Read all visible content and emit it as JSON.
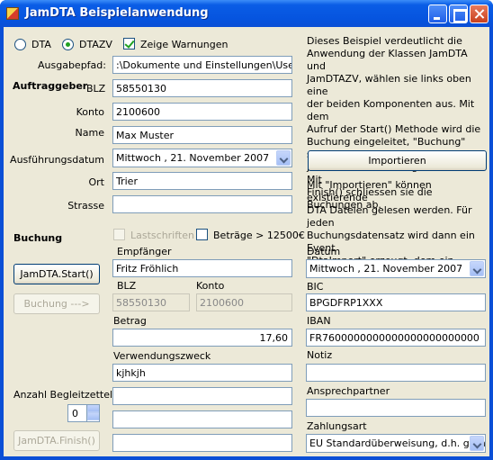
{
  "window": {
    "title": "JamDTA Beispielanwendung",
    "buttons": {
      "minimize": "minimize-icon",
      "maximize": "maximize-icon",
      "close": "close-icon"
    }
  },
  "mode": {
    "dta_label": "DTA",
    "dtazv_label": "DTAZV",
    "selected": "DTAZV",
    "warn_label": "Zeige Warnungen",
    "warn_checked": true
  },
  "output": {
    "label": "Ausgabepfad:",
    "value": ":\\Dokumente und Einstellungen\\User"
  },
  "auftraggeber": {
    "section_label": "Auftraggeber",
    "blz_label": "BLZ",
    "blz_value": "58550130",
    "konto_label": "Konto",
    "konto_value": "2100600",
    "name_label": "Name",
    "name_value": "Max Muster",
    "date_label": "Ausführungsdatum",
    "date_value": "Mittwoch  , 21. November 2007",
    "ort_label": "Ort",
    "ort_value": "Trier",
    "strasse_label": "Strasse",
    "strasse_value": ""
  },
  "buchung": {
    "section_label": "Buchung",
    "lastschriften_label": "Lastschriften",
    "betraege_label": "Beträge > 12500€",
    "empfaenger_label": "Empfänger",
    "empfaenger_value": "Fritz Fröhlich",
    "blz_label": "BLZ",
    "blz_value": "58550130",
    "konto_label": "Konto",
    "konto_value": "2100600",
    "betrag_label": "Betrag",
    "betrag_value": "17,60",
    "zweck_label": "Verwendungszweck",
    "zweck_value": "kjhkjh",
    "start_button": "JamDTA.Start()",
    "buchung_button": "Buchung --->",
    "finish_button": "JamDTA.Finish()",
    "begleitzettel_label": "Anzahl Begleitzettel",
    "begleitzettel_value": "0"
  },
  "right": {
    "intro_text": "Dieses Beispiel verdeutlicht die\nAnwendung der Klassen JamDTA und\nJamDTAZV, wählen sie links oben eine\nder beiden Komponenten aus. Mit dem\nAufruf der Start() Methode wird die\nBuchung eingeleitet, \"Buchung\" schreibt\njeweils einen Buchungsdatensatz. Mit\nFinish() schliessen sie die Buchungen ab.",
    "import_button": "Importieren",
    "import_text": "Mit \"Importieren\" können existierende\nDTA Dateien gelesen werden. Für jeden\nBuchungsdatensatz wird dann ein Event\n\"DtaImport\" erzeugt, dem ein\nBuchungsdatensatz übergeben wird",
    "datum_label": "Datum",
    "datum_value": "Mittwoch  , 21. November 2007",
    "bic_label": "BIC",
    "bic_value": "BPGDFRP1XXX",
    "iban_label": "IBAN",
    "iban_value": "FR7600000000000000000000000",
    "notiz_label": "Notiz",
    "notiz_value": "",
    "ansprech_label": "Ansprechpartner",
    "ansprech_value": "",
    "zahlungsart_label": "Zahlungsart",
    "zahlungsart_value": "EU Standardüberweisung, d.h. grenz"
  }
}
